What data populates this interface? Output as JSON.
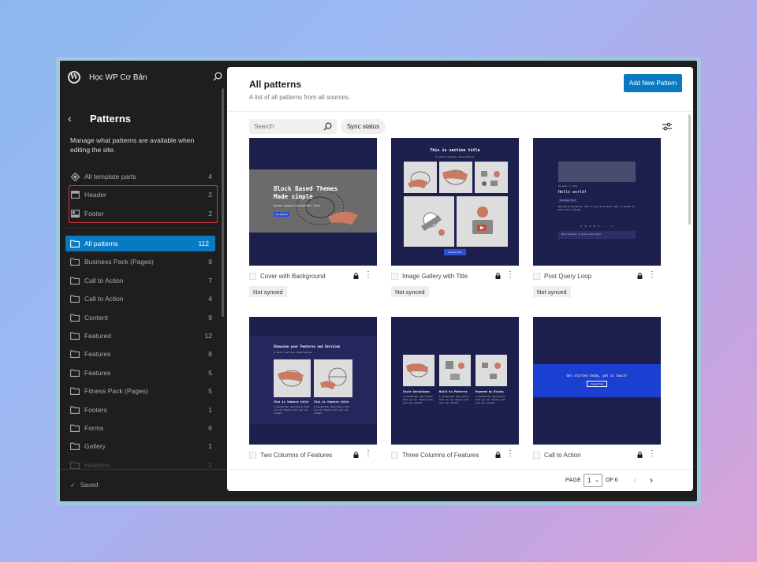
{
  "site": {
    "title": "Học WP Cơ Bản"
  },
  "sidebar": {
    "title": "Patterns",
    "description": "Manage what patterns are available when editing the site.",
    "template_parts": [
      {
        "label": "All template parts",
        "count": "4",
        "icon": "diamond-icon"
      },
      {
        "label": "Header",
        "count": "2",
        "icon": "header-layout-icon"
      },
      {
        "label": "Footer",
        "count": "2",
        "icon": "footer-layout-icon"
      }
    ],
    "categories": [
      {
        "label": "All patterns",
        "count": "112",
        "active": true
      },
      {
        "label": "Business Pack (Pages)",
        "count": "9"
      },
      {
        "label": "Call to Action",
        "count": "7"
      },
      {
        "label": "Call to Action",
        "count": "4"
      },
      {
        "label": "Content",
        "count": "9"
      },
      {
        "label": "Featured",
        "count": "12"
      },
      {
        "label": "Features",
        "count": "8"
      },
      {
        "label": "Features",
        "count": "5"
      },
      {
        "label": "Fitness Pack (Pages)",
        "count": "5"
      },
      {
        "label": "Footers",
        "count": "1"
      },
      {
        "label": "Forms",
        "count": "6"
      },
      {
        "label": "Gallery",
        "count": "1"
      },
      {
        "label": "Headers",
        "count": "2"
      }
    ],
    "saved_label": "Saved"
  },
  "main": {
    "title": "All patterns",
    "subtitle": "A list of all patterns from all sources.",
    "add_button": "Add New Pattern",
    "search_placeholder": "Search",
    "sync_button": "Sync status",
    "cards": [
      {
        "name": "Cover with Background",
        "badge": "Not synced",
        "thumb": {
          "heading": "Block Based Themes Made simple",
          "text": "Lorem ipsum placeholder text",
          "button": "Get Started"
        }
      },
      {
        "name": "Image Gallery with Title",
        "badge": "Not synced",
        "thumb": {
          "heading": "This is section title",
          "text": "A short section description",
          "button": "Review Tool"
        }
      },
      {
        "name": "Post Query Loop",
        "badge": "Not synced",
        "thumb": {
          "heading": "Hello world!",
          "text": "Welcome to WordPress. This is your first post. Edit or delete it, then start writing!",
          "meta": "December 2, 2024",
          "tag": "Uncategorized",
          "pager": "1 2 3 4 5 ... 7",
          "footer": "Unfortunately no posts were found"
        }
      },
      {
        "name": "Two Columns of Features",
        "badge": "",
        "thumb": {
          "heading": "Showcase your Features and Services",
          "text": "A short section description",
          "col1": "This is feature title",
          "col2": "This is feature title",
          "col_text": "A placeholder description that you can replace with your own content."
        }
      },
      {
        "name": "Three Columns of Features",
        "badge": "",
        "thumb": {
          "col1": "Style Variations",
          "col2": "Built-in Patterns",
          "col3": "Powered by Blocks",
          "col_text": "A placeholder description that you can replace with your own content."
        }
      },
      {
        "name": "Call to Action",
        "badge": "",
        "thumb": {
          "heading": "Get started today, get in touch!",
          "button": "Contact Tool"
        }
      }
    ],
    "pagination": {
      "page_label": "PAGE",
      "current": "1",
      "of_label": "OF 6"
    }
  },
  "colors": {
    "accent": "#0a7ac0",
    "thumb_bg": "#1d1f4d",
    "highlight": "#e0343c"
  }
}
